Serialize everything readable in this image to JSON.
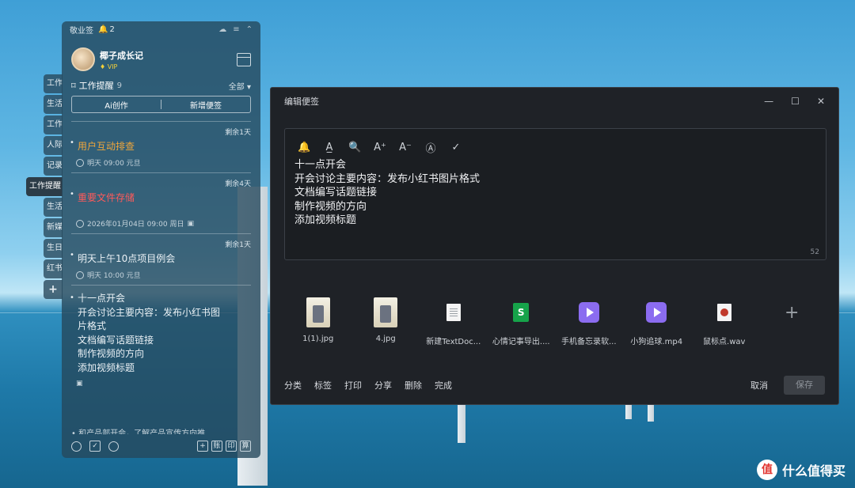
{
  "background": {
    "sky": "#5fb6e3",
    "sea": "#1e79a8"
  },
  "side_tabs": {
    "items": [
      "工作",
      "生活",
      "工作",
      "人际",
      "记录",
      "工作提醒",
      "生活",
      "新媒",
      "生日",
      "红书",
      "+"
    ],
    "active_index": 5
  },
  "panel": {
    "header": {
      "title": "敬业签",
      "badge_count": "2"
    },
    "profile": {
      "name": "椰子成长记",
      "vip": "VIP"
    },
    "section": {
      "title": "工作提醒",
      "count": "9",
      "filter": "全部"
    },
    "actions": {
      "ai": "Ai创作",
      "new_note": "新增便签"
    },
    "notes": [
      {
        "remain": "剩余1天",
        "title": "用户互动排查",
        "time": "明天 09:00 元旦",
        "color": "#f0a63b"
      },
      {
        "remain": "剩余4天",
        "title": "重要文件存储",
        "time": "2026年01月04日 09:00 周日",
        "color": "#ff5a5a"
      },
      {
        "remain": "剩余1天",
        "title": "明天上午10点项目例会",
        "time": "明天 10:00 元旦",
        "color": "#ffffff"
      },
      {
        "remain": "",
        "lines": [
          "十一点开会",
          "开会讨论主要内容：发布小红书图",
          "片格式",
          "文档编写话题链接",
          "制作视频的方向",
          "添加视频标题"
        ]
      }
    ],
    "cut_note": "• 和产品部开会，了解产品宣传方向推"
  },
  "footer": {
    "icons": [
      "clock-icon",
      "checkbox-icon",
      "search-icon"
    ],
    "right_buttons": [
      "+",
      "账",
      "印",
      "算"
    ]
  },
  "editor": {
    "title": "编辑便签",
    "toolbar": [
      "🔔",
      "A̲",
      "🔍",
      "A⁺",
      "A⁻",
      "Ⓐ",
      "✓"
    ],
    "content": [
      "十一点开会",
      "开会讨论主要内容：发布小红书图片格式",
      "文档编写话题链接",
      "制作视频的方向",
      "添加视频标题"
    ],
    "char_count": "52",
    "files": [
      {
        "name": "1(1).jpg",
        "type": "image"
      },
      {
        "name": "4.jpg",
        "type": "image"
      },
      {
        "name": "新建TextDoc...",
        "type": "doc"
      },
      {
        "name": "心情记事导出....",
        "type": "sheet"
      },
      {
        "name": "手机备忘录软...",
        "type": "video"
      },
      {
        "name": "小狗追球.mp4",
        "type": "video"
      },
      {
        "name": "鼠标点.wav",
        "type": "audio"
      }
    ],
    "actions": [
      "分类",
      "标签",
      "打印",
      "分享",
      "删除",
      "完成"
    ],
    "cancel": "取消",
    "save": "保存"
  },
  "watermark": {
    "text": "什么值得买",
    "logo": "值"
  }
}
